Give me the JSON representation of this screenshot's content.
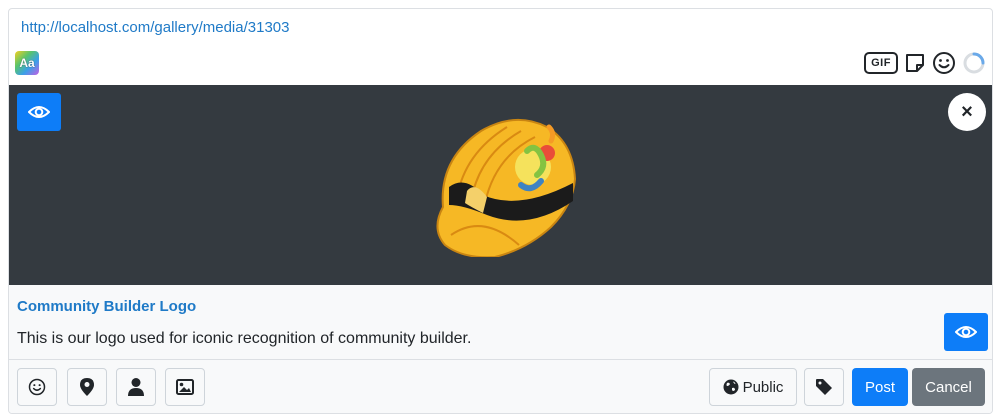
{
  "composer": {
    "url": "http://localhost.com/gallery/media/31303",
    "format_label": "Aa",
    "gif_label": "GIF"
  },
  "media": {
    "title": "Community Builder Logo",
    "description": "This is our logo used for iconic recognition of community builder.",
    "close_label": "×"
  },
  "footer": {
    "public_label": "Public",
    "post_label": "Post",
    "cancel_label": "Cancel"
  },
  "icons": {
    "format": "text-format-icon",
    "gif": "gif-icon",
    "sticker": "sticker-icon",
    "emoji": "emoji-icon",
    "loading": "spinner-icon",
    "preview": "eye-icon",
    "close": "close-icon",
    "location": "map-marker-icon",
    "user": "user-icon",
    "image": "image-icon",
    "globe": "globe-icon",
    "tag": "tag-icon"
  },
  "colors": {
    "primary": "#0d7df8",
    "secondary": "#6c757d",
    "link": "#1f7ac7",
    "media_bg": "#343a40"
  }
}
